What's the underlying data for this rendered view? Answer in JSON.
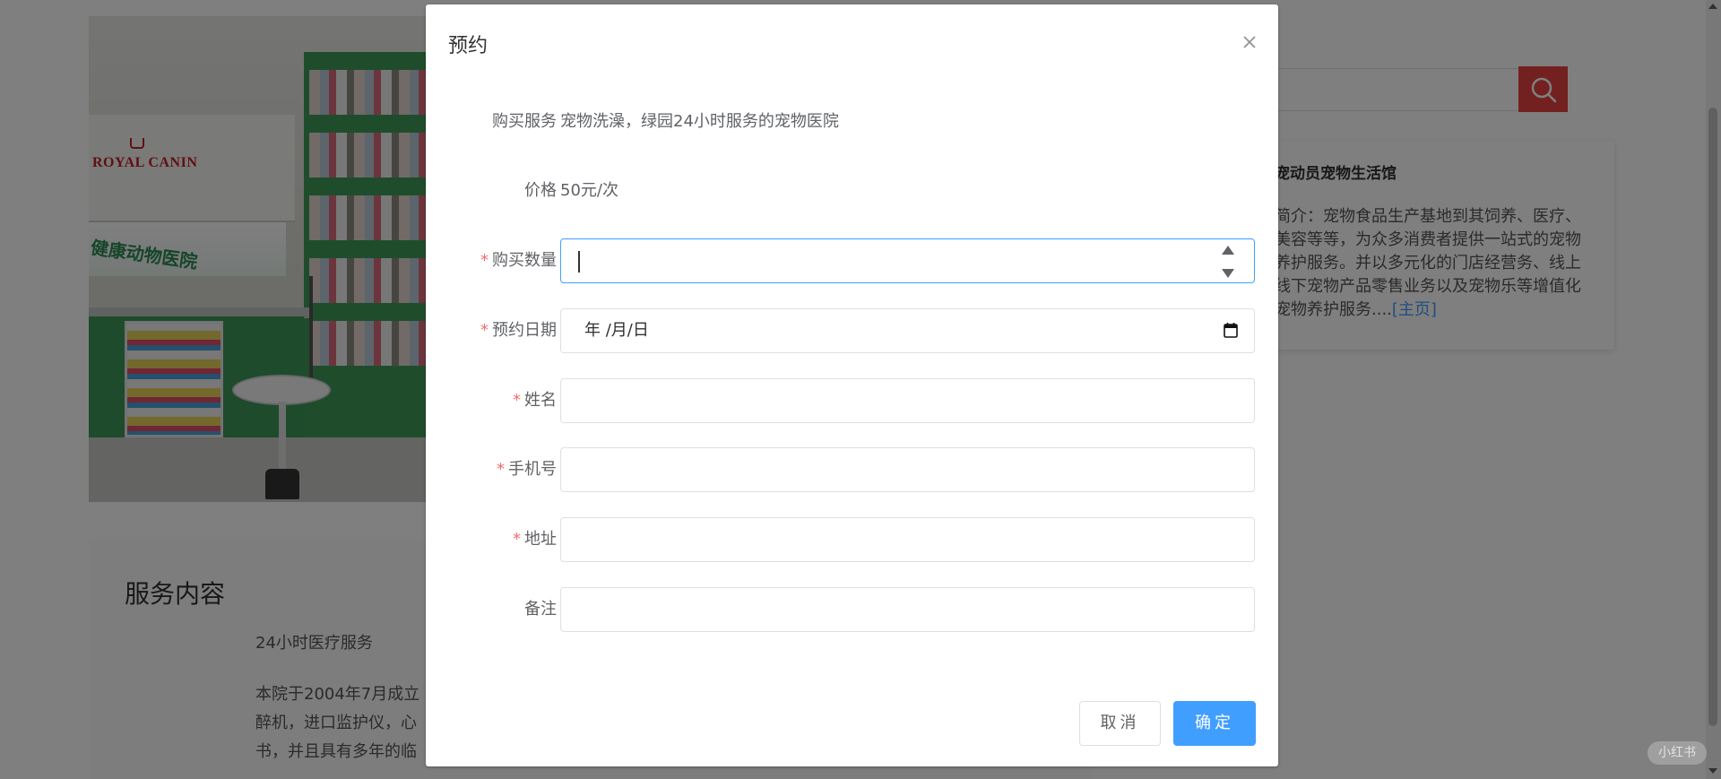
{
  "background": {
    "photo": {
      "logo_text": "ROYAL CANIN",
      "sign_text": "健康动物医院"
    },
    "service": {
      "title": "服务内容",
      "subtitle": "24小时医疗服务",
      "body_lines": [
        "本院于2004年7月成立",
        "醉机，进口监护仪，心",
        "书，并且具有多年的临"
      ]
    },
    "store": {
      "name": "宠动员宠物生活馆",
      "intro": "简介：宠物食品生产基地到其饲养、医疗、美容等等，为众多消费者提供一站式的宠物养护服务。并以多元化的门店经营务、线上线下宠物产品零售业务以及宠物乐等增值化宠物养护服务....",
      "link_label": "[主页]"
    },
    "watermark": "小红书"
  },
  "dialog": {
    "title": "预约",
    "close_icon": "close-icon",
    "fields": {
      "service_label": "购买服务",
      "service_value": "宠物洗澡，绿园24小时服务的宠物医院",
      "price_label": "价格",
      "price_value": "50元/次",
      "quantity_label": "购买数量",
      "quantity_value": "",
      "date_label": "预约日期",
      "date_placeholder": "年 /月/日",
      "name_label": "姓名",
      "name_value": "",
      "phone_label": "手机号",
      "phone_value": "",
      "address_label": "地址",
      "address_value": "",
      "remark_label": "备注",
      "remark_value": ""
    },
    "required_mark": "*",
    "cancel_label": "取消",
    "confirm_label": "确定"
  },
  "colors": {
    "primary": "#409eff",
    "required": "#f56c6c",
    "search_button": "#e64340",
    "overlay": "rgba(0,0,0,0.5)"
  }
}
